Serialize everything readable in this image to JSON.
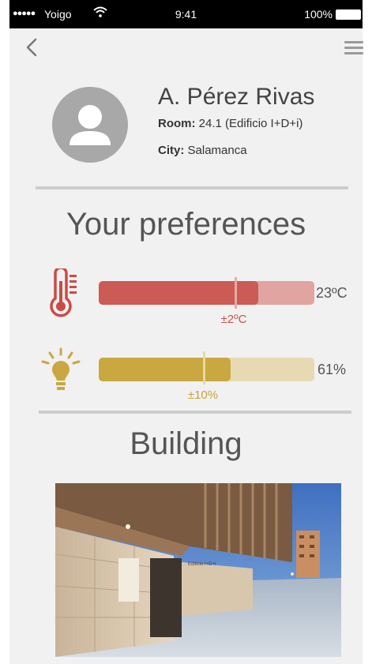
{
  "status_bar": {
    "signal": "●●●●●",
    "carrier": "Yoigo",
    "time": "9:41",
    "battery": "100%"
  },
  "profile": {
    "name": "A. Pérez Rivas",
    "room_label": "Room:",
    "room_value": "24.1 (Edificio I+D+i)",
    "city_label": "City:",
    "city_value": "Salamanca"
  },
  "preferences": {
    "title": "Your preferences",
    "temperature": {
      "value": "23ºC",
      "tolerance": "±2ºC",
      "level": 0.74,
      "marker": 0.64,
      "color": "#cc5a55"
    },
    "light": {
      "value": "61%",
      "tolerance": "±10%",
      "level": 0.61,
      "marker": 0.49,
      "color": "#c9a842"
    }
  },
  "building": {
    "title": "Building",
    "sign_text": "Edificio I+D+i"
  },
  "icons": [
    "back-icon",
    "menu-icon",
    "user-icon",
    "thermometer-icon",
    "light-bulb-icon",
    "wifi-icon",
    "battery-icon"
  ]
}
